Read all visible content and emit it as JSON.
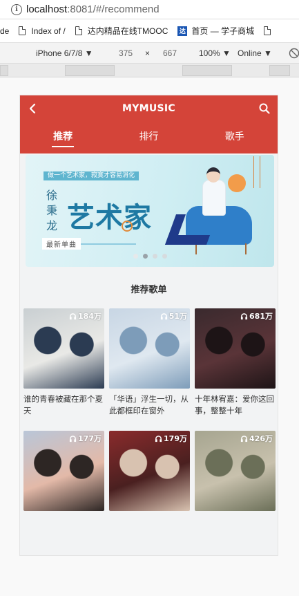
{
  "browser": {
    "url_host": "localhost",
    "url_rest": ":8081/#/recommend",
    "bookmarks": [
      "de",
      "Index of /",
      "达内精品在线TMOOC",
      "首页 — 学子商城",
      ""
    ]
  },
  "devtools": {
    "device": "iPhone 6/7/8",
    "width": "375",
    "times": "×",
    "height": "667",
    "zoom": "100%",
    "network": "Online"
  },
  "app": {
    "title": "MYMUSIC",
    "tabs": [
      "推荐",
      "排行",
      "歌手"
    ],
    "active_tab": 0,
    "banner": {
      "tagline": "做一个艺术家，寂寞才容易消化",
      "artist": "徐秉龙",
      "headline": "艺术家",
      "subtitle": "最新单曲",
      "dot_count": 4,
      "active_dot": 1
    },
    "section_title": "推荐歌单",
    "playlists": [
      {
        "count": "184万",
        "title": "谁的青春被藏在那个夏天",
        "colors": [
          "#c9cfd2",
          "#e9e9e6",
          "#2b3b52"
        ]
      },
      {
        "count": "51万",
        "title": "「华语」浮生一切，从此都框印在窗外",
        "colors": [
          "#c8d6e4",
          "#dfe8f0",
          "#7d9cb9"
        ]
      },
      {
        "count": "681万",
        "title": "十年林宥嘉：爱你这回事，整整十年",
        "colors": [
          "#3a2a2e",
          "#5a3438",
          "#1d1416"
        ]
      },
      {
        "count": "177万",
        "title": "",
        "colors": [
          "#b9c6d8",
          "#e3b9a8",
          "#2d2624"
        ]
      },
      {
        "count": "179万",
        "title": "",
        "colors": [
          "#8a2b2c",
          "#4a2020",
          "#d8c2b0"
        ]
      },
      {
        "count": "426万",
        "title": "",
        "colors": [
          "#a6a590",
          "#c8c1ad",
          "#6b6f58"
        ]
      }
    ]
  }
}
